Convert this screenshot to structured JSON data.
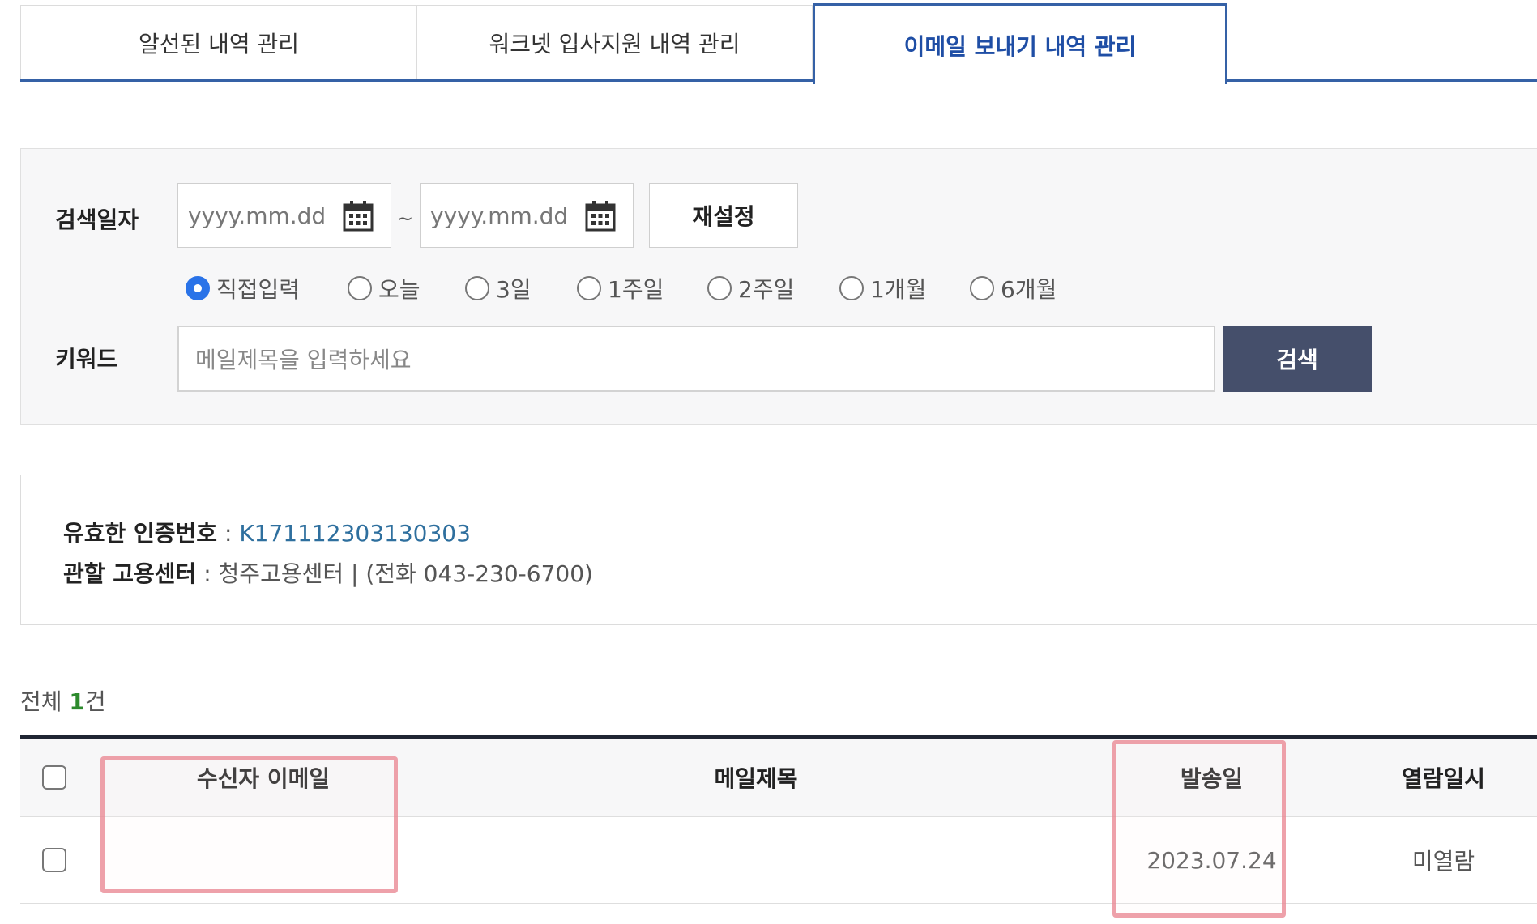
{
  "tabs": [
    {
      "label": "알선된 내역 관리",
      "active": false
    },
    {
      "label": "워크넷 입사지원 내역 관리",
      "active": false
    },
    {
      "label": "이메일 보내기 내역 관리",
      "active": true
    }
  ],
  "search": {
    "date_label": "검색일자",
    "start_placeholder": "yyyy.mm.dd",
    "end_placeholder": "yyyy.mm.dd",
    "tilde": "~",
    "reset_label": "재설정",
    "periods": [
      {
        "label": "직접입력",
        "selected": true
      },
      {
        "label": "오늘",
        "selected": false
      },
      {
        "label": "3일",
        "selected": false
      },
      {
        "label": "1주일",
        "selected": false
      },
      {
        "label": "2주일",
        "selected": false
      },
      {
        "label": "1개월",
        "selected": false
      },
      {
        "label": "6개월",
        "selected": false
      }
    ],
    "keyword_label": "키워드",
    "keyword_placeholder": "메일제목을 입력하세요",
    "search_label": "검색"
  },
  "info": {
    "cert_label": "유효한 인증번호",
    "cert_value": "K171112303130303",
    "center_label": "관할 고용센터",
    "center_value": "청주고용센터 | (전화 043-230-6700)",
    "separator": " : "
  },
  "total": {
    "prefix": "전체 ",
    "count": "1",
    "suffix": "건"
  },
  "table": {
    "headers": [
      "수신자 이메일",
      "메일제목",
      "발송일",
      "열람일시"
    ],
    "rows": [
      {
        "email": "",
        "subject": "",
        "sent_date": "2023.07.24",
        "read_status": "미열람"
      }
    ]
  },
  "colors": {
    "accent": "#3561a6",
    "search_button": "#454f6b",
    "link": "#2e6f9e",
    "count": "#2c8a2c",
    "highlight": "#e8828e"
  },
  "icons": [
    "calendar-icon",
    "radio-selected-icon",
    "radio-empty-icon",
    "checkbox-icon"
  ]
}
